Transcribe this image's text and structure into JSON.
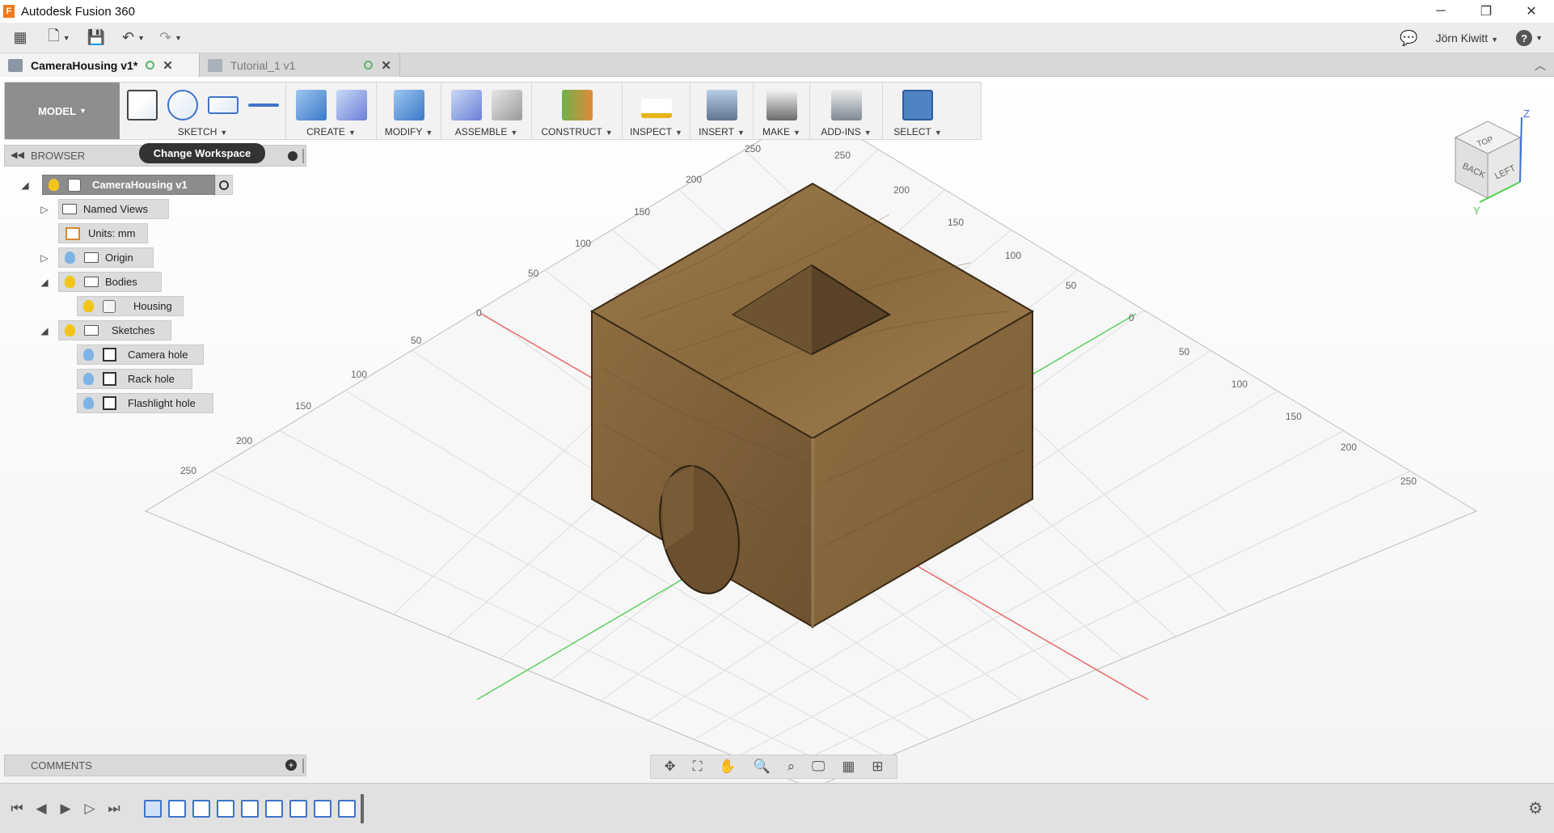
{
  "window": {
    "title": "Autodesk Fusion 360",
    "logo_letter": "F"
  },
  "window_controls": {
    "minimize": "─",
    "restore": "❐",
    "close": "✕"
  },
  "quick_access": {
    "user": "Jörn Kiwitt",
    "help": "?"
  },
  "tabs": [
    {
      "label": "CameraHousing v1*",
      "active": true
    },
    {
      "label": "Tutorial_1 v1",
      "active": false
    }
  ],
  "toolbar": {
    "workspace": "MODEL",
    "groups": {
      "sketch": "SKETCH",
      "create": "CREATE",
      "modify": "MODIFY",
      "assemble": "ASSEMBLE",
      "construct": "CONSTRUCT",
      "inspect": "INSPECT",
      "insert": "INSERT",
      "make": "MAKE",
      "addins": "ADD-INS",
      "select": "SELECT"
    }
  },
  "tooltip": "Change Workspace",
  "browser": {
    "title": "BROWSER",
    "root": "CameraHousing v1",
    "items": {
      "named_views": "Named Views",
      "units": "Units: mm",
      "origin": "Origin",
      "bodies": "Bodies",
      "housing": "Housing",
      "sketches": "Sketches",
      "camera_hole": "Camera hole",
      "rack_hole": "Rack hole",
      "flashlight_hole": "Flashlight hole"
    }
  },
  "comments": {
    "title": "COMMENTS"
  },
  "viewcube": {
    "top": "TOP",
    "back": "BACK",
    "left": "LEFT",
    "z_axis": "Z",
    "y_axis": "Y"
  },
  "grid_labels": {
    "left_axis": [
      "250",
      "200",
      "150",
      "100",
      "50",
      "0",
      "50",
      "100",
      "150",
      "200",
      "250"
    ],
    "right_axis": [
      "250",
      "200",
      "150",
      "100",
      "50",
      "0",
      "50",
      "100",
      "150",
      "200",
      "250"
    ]
  },
  "colors": {
    "accent_select": "#4f83c3",
    "wood": "#8a6a3e",
    "axis_red": "#e86a6a",
    "axis_green": "#5fd05f"
  }
}
